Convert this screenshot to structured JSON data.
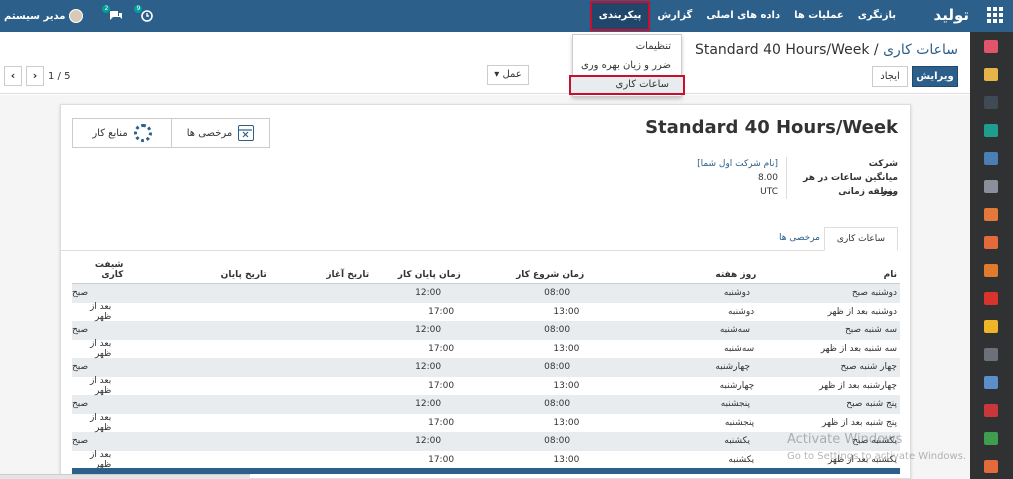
{
  "navbar": {
    "brand": "تولید",
    "menu": [
      "بازنگری",
      "عملیات ها",
      "داده های اصلی",
      "گزارش",
      "پیکربندی"
    ],
    "active_menu": "پیکربندی",
    "user_name": "مدیر سیستم",
    "messages_count": "2",
    "activities_count": "9"
  },
  "breadcrumb": {
    "parent": "ساعات کاری",
    "separator": "/",
    "current": "Standard 40 Hours/Week"
  },
  "buttons": {
    "edit": "ویرایش",
    "create": "ایجاد",
    "action": "عمل"
  },
  "pager": {
    "value": "1 / 5"
  },
  "dropdown": {
    "items": [
      "تنظیمات",
      "ضرر و زیان بهره وری",
      "ساعات کاری"
    ],
    "selected": "ساعات کاری"
  },
  "stat_buttons": {
    "time_off": "مرخصی ها",
    "work_resources": "منابع کار"
  },
  "form": {
    "title": "Standard 40 Hours/Week",
    "company_label": "شرکت",
    "company_value": "[نام شرکت اول شما]",
    "avg_hours_label": "میانگین ساعات در هر روز",
    "avg_hours_value": "8.00",
    "timezone_label": "منطقه زمانی",
    "timezone_value": "UTC"
  },
  "tabs": [
    "ساعات کاری",
    "مرخصی ها"
  ],
  "table": {
    "headers": [
      "نام",
      "روز هفته",
      "زمان شروع کار",
      "زمان پایان کار",
      "تاریخ آغاز",
      "تاریخ پایان",
      "شیفت کاری"
    ],
    "rows": [
      [
        "دوشنبه صبح",
        "دوشنبه",
        "08:00",
        "12:00",
        "",
        "",
        "صبح"
      ],
      [
        "دوشنبه بعد از ظهر",
        "دوشنبه",
        "13:00",
        "17:00",
        "",
        "",
        "بعد از ظهر"
      ],
      [
        "سه شنبه صبح",
        "سه‌شنبه",
        "08:00",
        "12:00",
        "",
        "",
        "صبح"
      ],
      [
        "سه شنبه بعد از ظهر",
        "سه‌شنبه",
        "13:00",
        "17:00",
        "",
        "",
        "بعد از ظهر"
      ],
      [
        "چهار شنبه صبح",
        "چهارشنبه",
        "08:00",
        "12:00",
        "",
        "",
        "صبح"
      ],
      [
        "چهارشنبه بعد از ظهر",
        "چهارشنبه",
        "13:00",
        "17:00",
        "",
        "",
        "بعد از ظهر"
      ],
      [
        "پنج شنبه صبح",
        "پنجشنبه",
        "08:00",
        "12:00",
        "",
        "",
        "صبح"
      ],
      [
        "پنج شنبه بعد از ظهر",
        "پنجشنبه",
        "13:00",
        "17:00",
        "",
        "",
        "بعد از ظهر"
      ],
      [
        "یکشنبه صبح",
        "یکشنبه",
        "08:00",
        "12:00",
        "",
        "",
        "صبح"
      ],
      [
        "یکشنبه بعد از ظهر",
        "یکشنبه",
        "13:00",
        "17:00",
        "",
        "",
        "بعد از ظهر"
      ]
    ]
  },
  "watermark": {
    "line1": "Activate Windows",
    "line2": "Go to Settings to activate Windows."
  },
  "colors": {
    "brand": "#2c5f8a",
    "highlight": "#c8102e",
    "sidebar": "#2f3133"
  }
}
